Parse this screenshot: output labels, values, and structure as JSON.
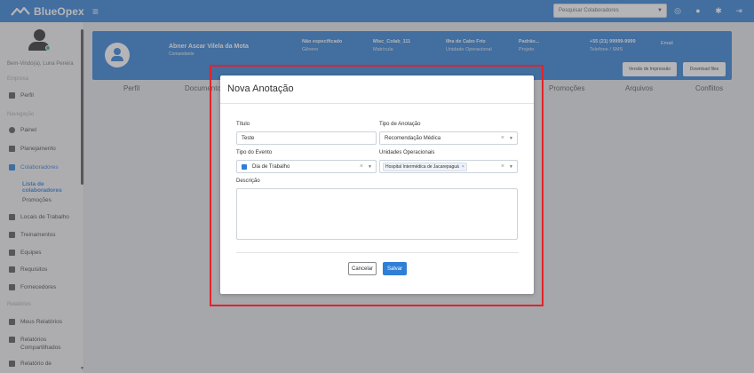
{
  "app": {
    "name": "BlueOpex",
    "brand_color": "#2f7fd6"
  },
  "topbar": {
    "search_placeholder": "Pesquisar Colaboradores",
    "icons": [
      "menu-icon",
      "headset-icon",
      "bell-icon",
      "gear-icon",
      "logout-icon"
    ]
  },
  "sidebar": {
    "user_name": "Bem-Vindo(a), Luna Pereira",
    "sections": {
      "company": "Empresa",
      "navigation": "Navegação",
      "reports": "Relatórios"
    },
    "items": {
      "perfil": "Perfil",
      "painel": "Painel",
      "planejamento": "Planejamento",
      "colaboradores": "Colaboradores",
      "lista": "Lista de colaboradores",
      "promocoes": "Promoções",
      "locais": "Locais de Trabalho",
      "treinamentos": "Treinamentos",
      "equipes": "Equipes",
      "requisitos": "Requisitos",
      "fornecedores": "Fornecedores",
      "meus_relatorios": "Meus Relatórios",
      "rel_comp_1": "Relatórios",
      "rel_comp_2": "Compartilhados",
      "rel_de": "Relatório de"
    }
  },
  "profile": {
    "name": "Abner Ascar Vilela da Mota",
    "role": "Comandante",
    "fields": [
      {
        "value": "Não especificado",
        "label": "Gênero"
      },
      {
        "value": "Misc_Colab_111",
        "label": "Matrícula"
      },
      {
        "value": "Ilha de Cabo Frio",
        "label": "Unidade Operacional"
      },
      {
        "value": "Padrão...",
        "label": "Projeto"
      },
      {
        "value": "+55 (21) 99999-9999",
        "label": "Telefone / SMS"
      },
      {
        "value": "Email",
        "label": ""
      }
    ],
    "buttons": {
      "print": "Versão de Impressão",
      "download": "Download files"
    }
  },
  "tabs": {
    "perfil": "Perfil",
    "documentos": "Documentos",
    "promocoes": "Promoções",
    "arquivos": "Arquivos",
    "conflitos": "Conflitos"
  },
  "modal": {
    "title": "Nova Anotação",
    "titulo_label": "Título",
    "titulo_value": "Teste",
    "tipo_anotacao_label": "Tipo de Anotação",
    "tipo_anotacao_value": "Recomendação Médica",
    "tipo_evento_label": "Tipo do Evento",
    "tipo_evento_value": "Dia de Trabalho",
    "unidades_label": "Unidades Operacionais",
    "unidades_chip": "Hospital Intermédica de Jacarepaguá",
    "descricao_label": "Descrição",
    "descricao_value": "",
    "cancel": "Cancelar",
    "save": "Salvar"
  },
  "highlight_color": "#e0242b"
}
